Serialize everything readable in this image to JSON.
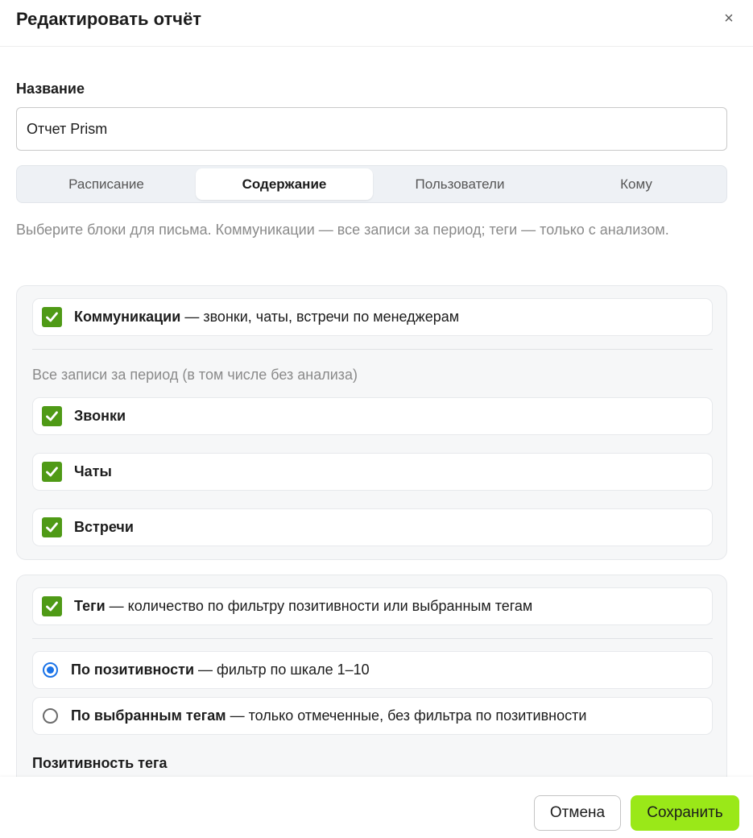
{
  "dialog": {
    "title": "Редактировать отчёт",
    "close_icon": "×"
  },
  "form": {
    "name_label": "Название",
    "name_value": "Отчет Prism"
  },
  "tabs": [
    {
      "label": "Расписание",
      "active": false
    },
    {
      "label": "Содержание",
      "active": true
    },
    {
      "label": "Пользователи",
      "active": false
    },
    {
      "label": "Кому",
      "active": false
    }
  ],
  "content": {
    "description": "Выберите блоки для письма. Коммуникации — все записи за период; теги — только с анализом.",
    "communications": {
      "checked": true,
      "title": "Коммуникации",
      "suffix": " — звонки, чаты, встречи по менеджерам",
      "subheading": "Все записи за период (в том числе без анализа)",
      "items": [
        {
          "label": "Звонки",
          "checked": true
        },
        {
          "label": "Чаты",
          "checked": true
        },
        {
          "label": "Встречи",
          "checked": true
        }
      ]
    },
    "tags": {
      "checked": true,
      "title": "Теги",
      "suffix": " — количество по фильтру позитивности или выбранным тегам",
      "options": [
        {
          "title": "По позитивности",
          "suffix": " — фильтр по шкале 1–10",
          "selected": true
        },
        {
          "title": "По выбранным тегам",
          "suffix": " — только отмеченные, без фильтра по позитивности",
          "selected": false
        }
      ],
      "positivity_label": "Позитивность тега"
    }
  },
  "footer": {
    "cancel_label": "Отмена",
    "save_label": "Сохранить"
  },
  "colors": {
    "checkbox": "#4f9a16",
    "radio": "#1a73e8",
    "save_button": "#9ae818"
  },
  "icons": {
    "close": "close-icon",
    "checkbox": "checkmark-icon",
    "radio": "radio-icon"
  }
}
